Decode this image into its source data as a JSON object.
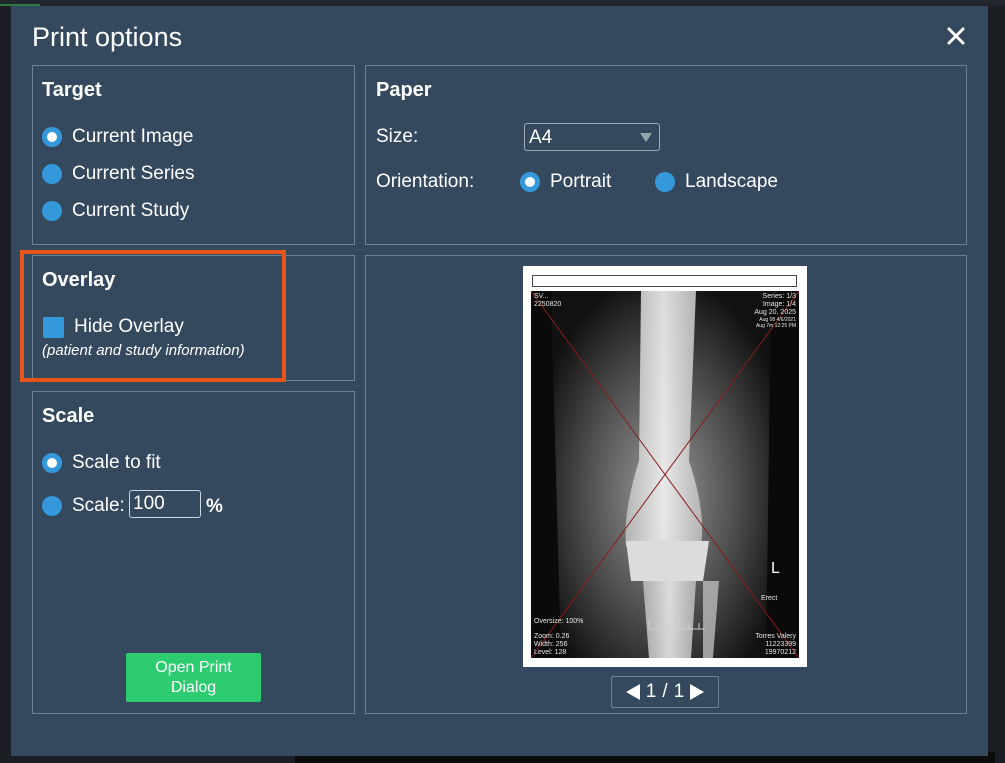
{
  "dialog": {
    "title": "Print options",
    "close_icon": "close-icon"
  },
  "target": {
    "title": "Target",
    "options": [
      {
        "label": "Current Image",
        "checked": true
      },
      {
        "label": "Current Series",
        "checked": false
      },
      {
        "label": "Current Study",
        "checked": false
      }
    ]
  },
  "paper": {
    "title": "Paper",
    "size_label": "Size:",
    "size_value": "A4",
    "orientation_label": "Orientation:",
    "orientation_options": [
      {
        "label": "Portrait",
        "checked": true
      },
      {
        "label": "Landscape",
        "checked": false
      }
    ]
  },
  "overlay": {
    "title": "Overlay",
    "hide_label": "Hide Overlay",
    "hide_checked": false,
    "note": "(patient and study information)"
  },
  "scale": {
    "title": "Scale",
    "fit_label": "Scale to fit",
    "fit_checked": true,
    "scale_label": "Scale:",
    "scale_value": "100",
    "percent": "%",
    "open_print_label": "Open Print\nDialog"
  },
  "preview": {
    "overlay_top_left": [
      "SV...",
      "2250820"
    ],
    "overlay_top_right": [
      "Series: 1/3",
      "Image: 1/4",
      "Aug 20, 2025",
      "Aug 08 4/6/2021",
      "Aug 7m 12:25 PM"
    ],
    "side_marker": "L",
    "position_text": "Erect",
    "oversize": "Oversize: 100%",
    "overlay_bottom_left": [
      "Zoom: 0.26",
      "Width: 256",
      "Level: 128"
    ],
    "overlay_bottom_right": [
      "Torres Valery",
      "11223399",
      "19970212"
    ]
  },
  "pager": {
    "current": "1",
    "separator": "/",
    "total": "1"
  },
  "colors": {
    "dialog_bg": "#34495e",
    "accent": "#3498db",
    "button_green": "#2ecc71",
    "highlight": "#e8541a"
  }
}
